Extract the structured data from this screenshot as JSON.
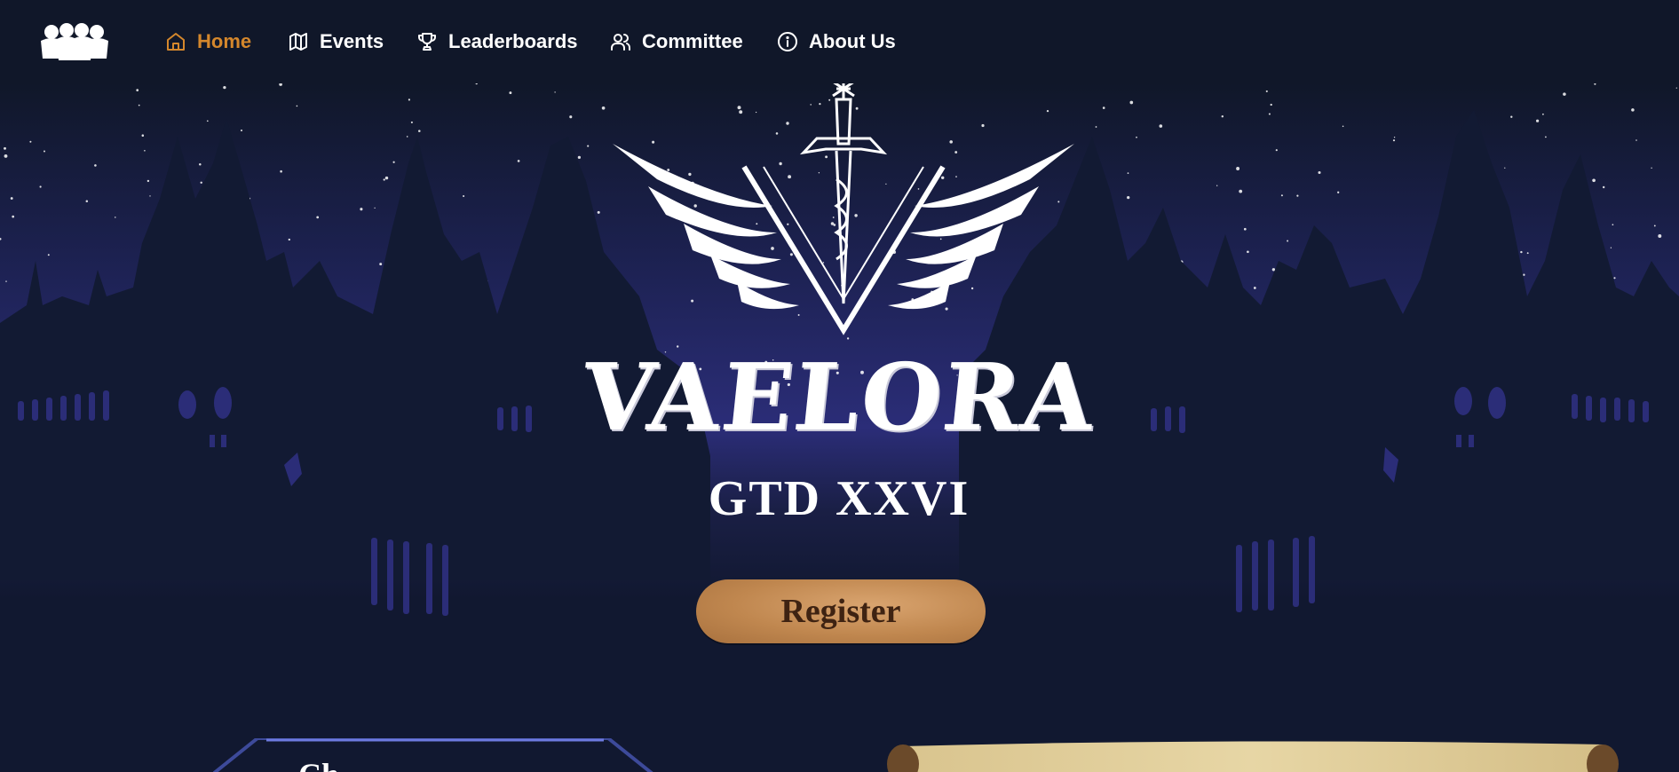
{
  "nav": {
    "logo_icon": "community-people-icon",
    "items": [
      {
        "label": "Home",
        "icon": "home-icon",
        "active": true
      },
      {
        "label": "Events",
        "icon": "map-icon",
        "active": false
      },
      {
        "label": "Leaderboards",
        "icon": "trophy-icon",
        "active": false
      },
      {
        "label": "Committee",
        "icon": "users-icon",
        "active": false
      },
      {
        "label": "About Us",
        "icon": "info-icon",
        "active": false
      }
    ]
  },
  "hero": {
    "title": "VAELORA",
    "subtitle": "GTD XXVI",
    "register_label": "Register",
    "panel_heading": "Ch"
  },
  "colors": {
    "background": "#111830",
    "navbar": "#101729",
    "sky_mid": "#2b2d78",
    "active_nav": "#d4872c",
    "button": "#c0874f",
    "button_text": "#3f2312"
  }
}
